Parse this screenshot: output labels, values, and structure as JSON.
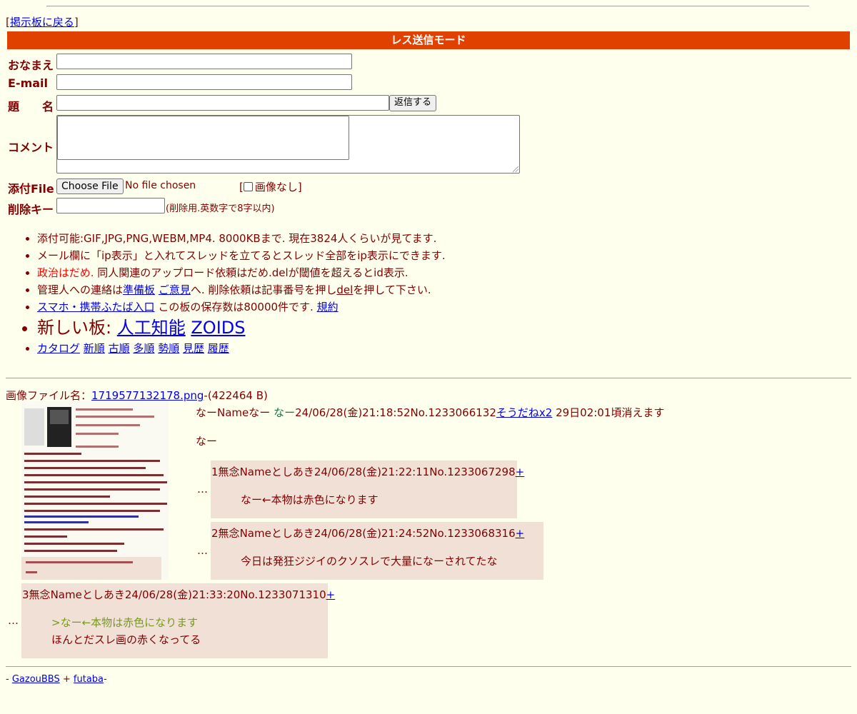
{
  "nav": {
    "back_link": "掲示板に戻る",
    "bracket_open": "[",
    "bracket_close": "]"
  },
  "mode_title": "レス送信モード",
  "form": {
    "name_label": "おなまえ",
    "email_label": "E-mail",
    "subject_label": "題　　名",
    "submit_label": "返信する",
    "comment_label": "コメント",
    "file_label": "添付File",
    "choose_file_label": "Choose File",
    "no_file_text": "No file chosen",
    "no_image_open": "[",
    "no_image_label": "画像なし",
    "no_image_close": "]",
    "delkey_label": "削除キー",
    "delkey_hint": "(削除用.英数字で8字以内)"
  },
  "rules": {
    "r1": "添付可能:GIF,JPG,PNG,WEBM,MP4. 8000KBまで. 現在3824人くらいが見てます.",
    "r2": "メール欄に「ip表示」と入れてスレッドを立てるとスレッド全部をip表示にできます.",
    "r3_red": "政治はだめ.",
    "r3_rest": " 同人関連のアップロード依頼はだめ.delが閾値を超えるとid表示.",
    "r4_a": "管理人への連絡は",
    "r4_link1": "準備板",
    "r4_link2": "ご意見",
    "r4_b": "へ. 削除依頼は記事番号を押し",
    "r4_del": "del",
    "r4_c": "を押して下さい.",
    "r5_link": "スマホ・携帯ふたば入口",
    "r5_text": " この板の保存数は80000件です. ",
    "r5_link2": "規約",
    "r6_text": "新しい板: ",
    "r6_link1": "人工知能",
    "r6_link2": "ZOIDS",
    "r7_links": [
      "カタログ",
      "新順",
      "古順",
      "多順",
      "勢順",
      "見歴",
      "履歴"
    ]
  },
  "thread": {
    "file_prefix": "画像ファイル名：",
    "file_name": "1719577132178.png",
    "file_size": "-(422464 B)",
    "op": {
      "subject": "なー",
      "name_label": "Name",
      "name": "なー",
      "datetime": "24/06/28(金)21:18:52",
      "no": "No.1233066132",
      "sodane": "そうだねx2",
      "expire": " 29日02:01頃消えます",
      "body": "なー"
    },
    "replies": [
      {
        "num": "1",
        "subject": "無念",
        "name_label": "Name",
        "name": "としあき",
        "datetime": "24/06/28(金)21:22:11",
        "no": "No.1233067298",
        "plus": "+",
        "quote": "",
        "body": "なー←本物は赤色になります"
      },
      {
        "num": "2",
        "subject": "無念",
        "name_label": "Name",
        "name": "としあき",
        "datetime": "24/06/28(金)21:24:52",
        "no": "No.1233068316",
        "plus": "+",
        "quote": "",
        "body": "今日は発狂ジジイのクソスレで大量になーされてたな"
      },
      {
        "num": "3",
        "subject": "無念",
        "name_label": "Name",
        "name": "としあき",
        "datetime": "24/06/28(金)21:33:20",
        "no": "No.1233071310",
        "plus": "+",
        "quote": ">なー←本物は赤色になります",
        "body": "ほんとだスレ画の赤くなってる"
      }
    ],
    "ellipsis": "…"
  },
  "footer": {
    "prefix": "- ",
    "link1": "GazouBBS",
    "mid": " + ",
    "link2": "futaba",
    "suffix": "-"
  },
  "colors": {
    "background": "#ffffee",
    "text": "#800000",
    "mode_bar": "#e04000",
    "reply_bg": "#f0e0d6",
    "link": "#0000ee",
    "quote": "#789922",
    "op_name": "#117743"
  }
}
